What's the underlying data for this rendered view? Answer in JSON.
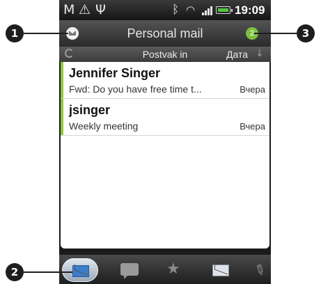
{
  "callouts": [
    "1",
    "2",
    "3"
  ],
  "status_bar": {
    "time": "19:09",
    "icons": [
      "gmail-icon",
      "warning-icon",
      "usb-icon",
      "bluetooth-icon",
      "wifi-icon",
      "signal-icon",
      "battery-icon"
    ]
  },
  "title_bar": {
    "title": "Personal mail",
    "unread_count": "2",
    "unread_color": "#7cc041"
  },
  "sub_bar": {
    "folder": "Postvak in",
    "sort_label": "Дата",
    "sort_arrow": "↓"
  },
  "messages": [
    {
      "from": "Jennifer Singer",
      "subject": "Fwd: Do you have free time t...",
      "date": "Вчера"
    },
    {
      "from": "jsinger",
      "subject": "Weekly meeting",
      "date": "Вчера"
    }
  ],
  "bottom_tabs": [
    {
      "icon": "mail-inbox-icon",
      "active": true
    },
    {
      "icon": "conversation-icon",
      "active": false
    },
    {
      "icon": "vip-star-icon",
      "active": false
    },
    {
      "icon": "unread-mail-icon",
      "active": false
    },
    {
      "icon": "attachment-icon",
      "active": false
    }
  ],
  "colors": {
    "unread_bar": "#8dc63f",
    "accent": "#7cc041"
  }
}
